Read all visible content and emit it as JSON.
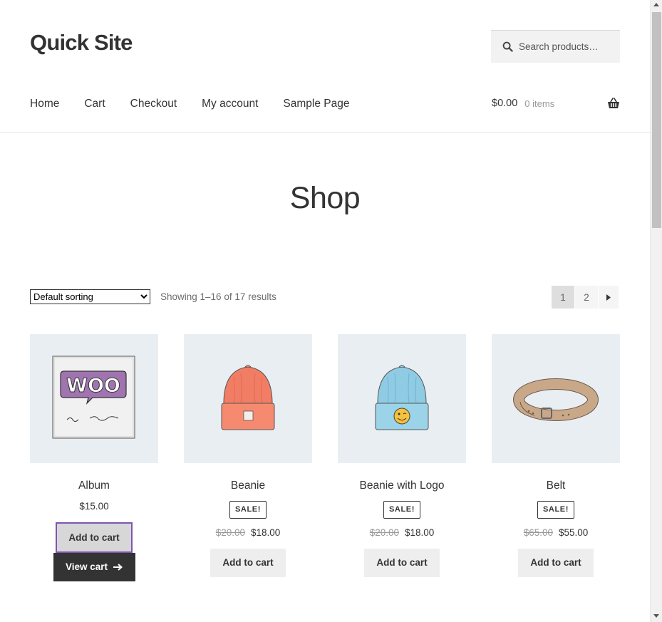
{
  "site": {
    "title": "Quick Site"
  },
  "search": {
    "placeholder": "Search products…"
  },
  "nav": {
    "items": [
      "Home",
      "Cart",
      "Checkout",
      "My account",
      "Sample Page"
    ]
  },
  "cart": {
    "amount": "$0.00",
    "items": "0 items"
  },
  "page": {
    "title": "Shop"
  },
  "toolbar": {
    "sort_selected": "Default sorting",
    "result_count": "Showing 1–16 of 17 results",
    "pages": [
      "1",
      "2"
    ],
    "current_page": "1"
  },
  "products": [
    {
      "title": "Album",
      "price": "$15.00",
      "button": "Add to cart",
      "view_cart": "View cart"
    },
    {
      "title": "Beanie",
      "sale_badge": "SALE!",
      "old_price": "$20.00",
      "price": "$18.00",
      "button": "Add to cart"
    },
    {
      "title": "Beanie with Logo",
      "sale_badge": "SALE!",
      "old_price": "$20.00",
      "price": "$18.00",
      "button": "Add to cart"
    },
    {
      "title": "Belt",
      "sale_badge": "SALE!",
      "old_price": "$65.00",
      "price": "$55.00",
      "button": "Add to cart"
    }
  ],
  "colors": {
    "accent_focus": "#7f54b3",
    "thumb_bg": "#e9eef2",
    "text": "#333333"
  }
}
